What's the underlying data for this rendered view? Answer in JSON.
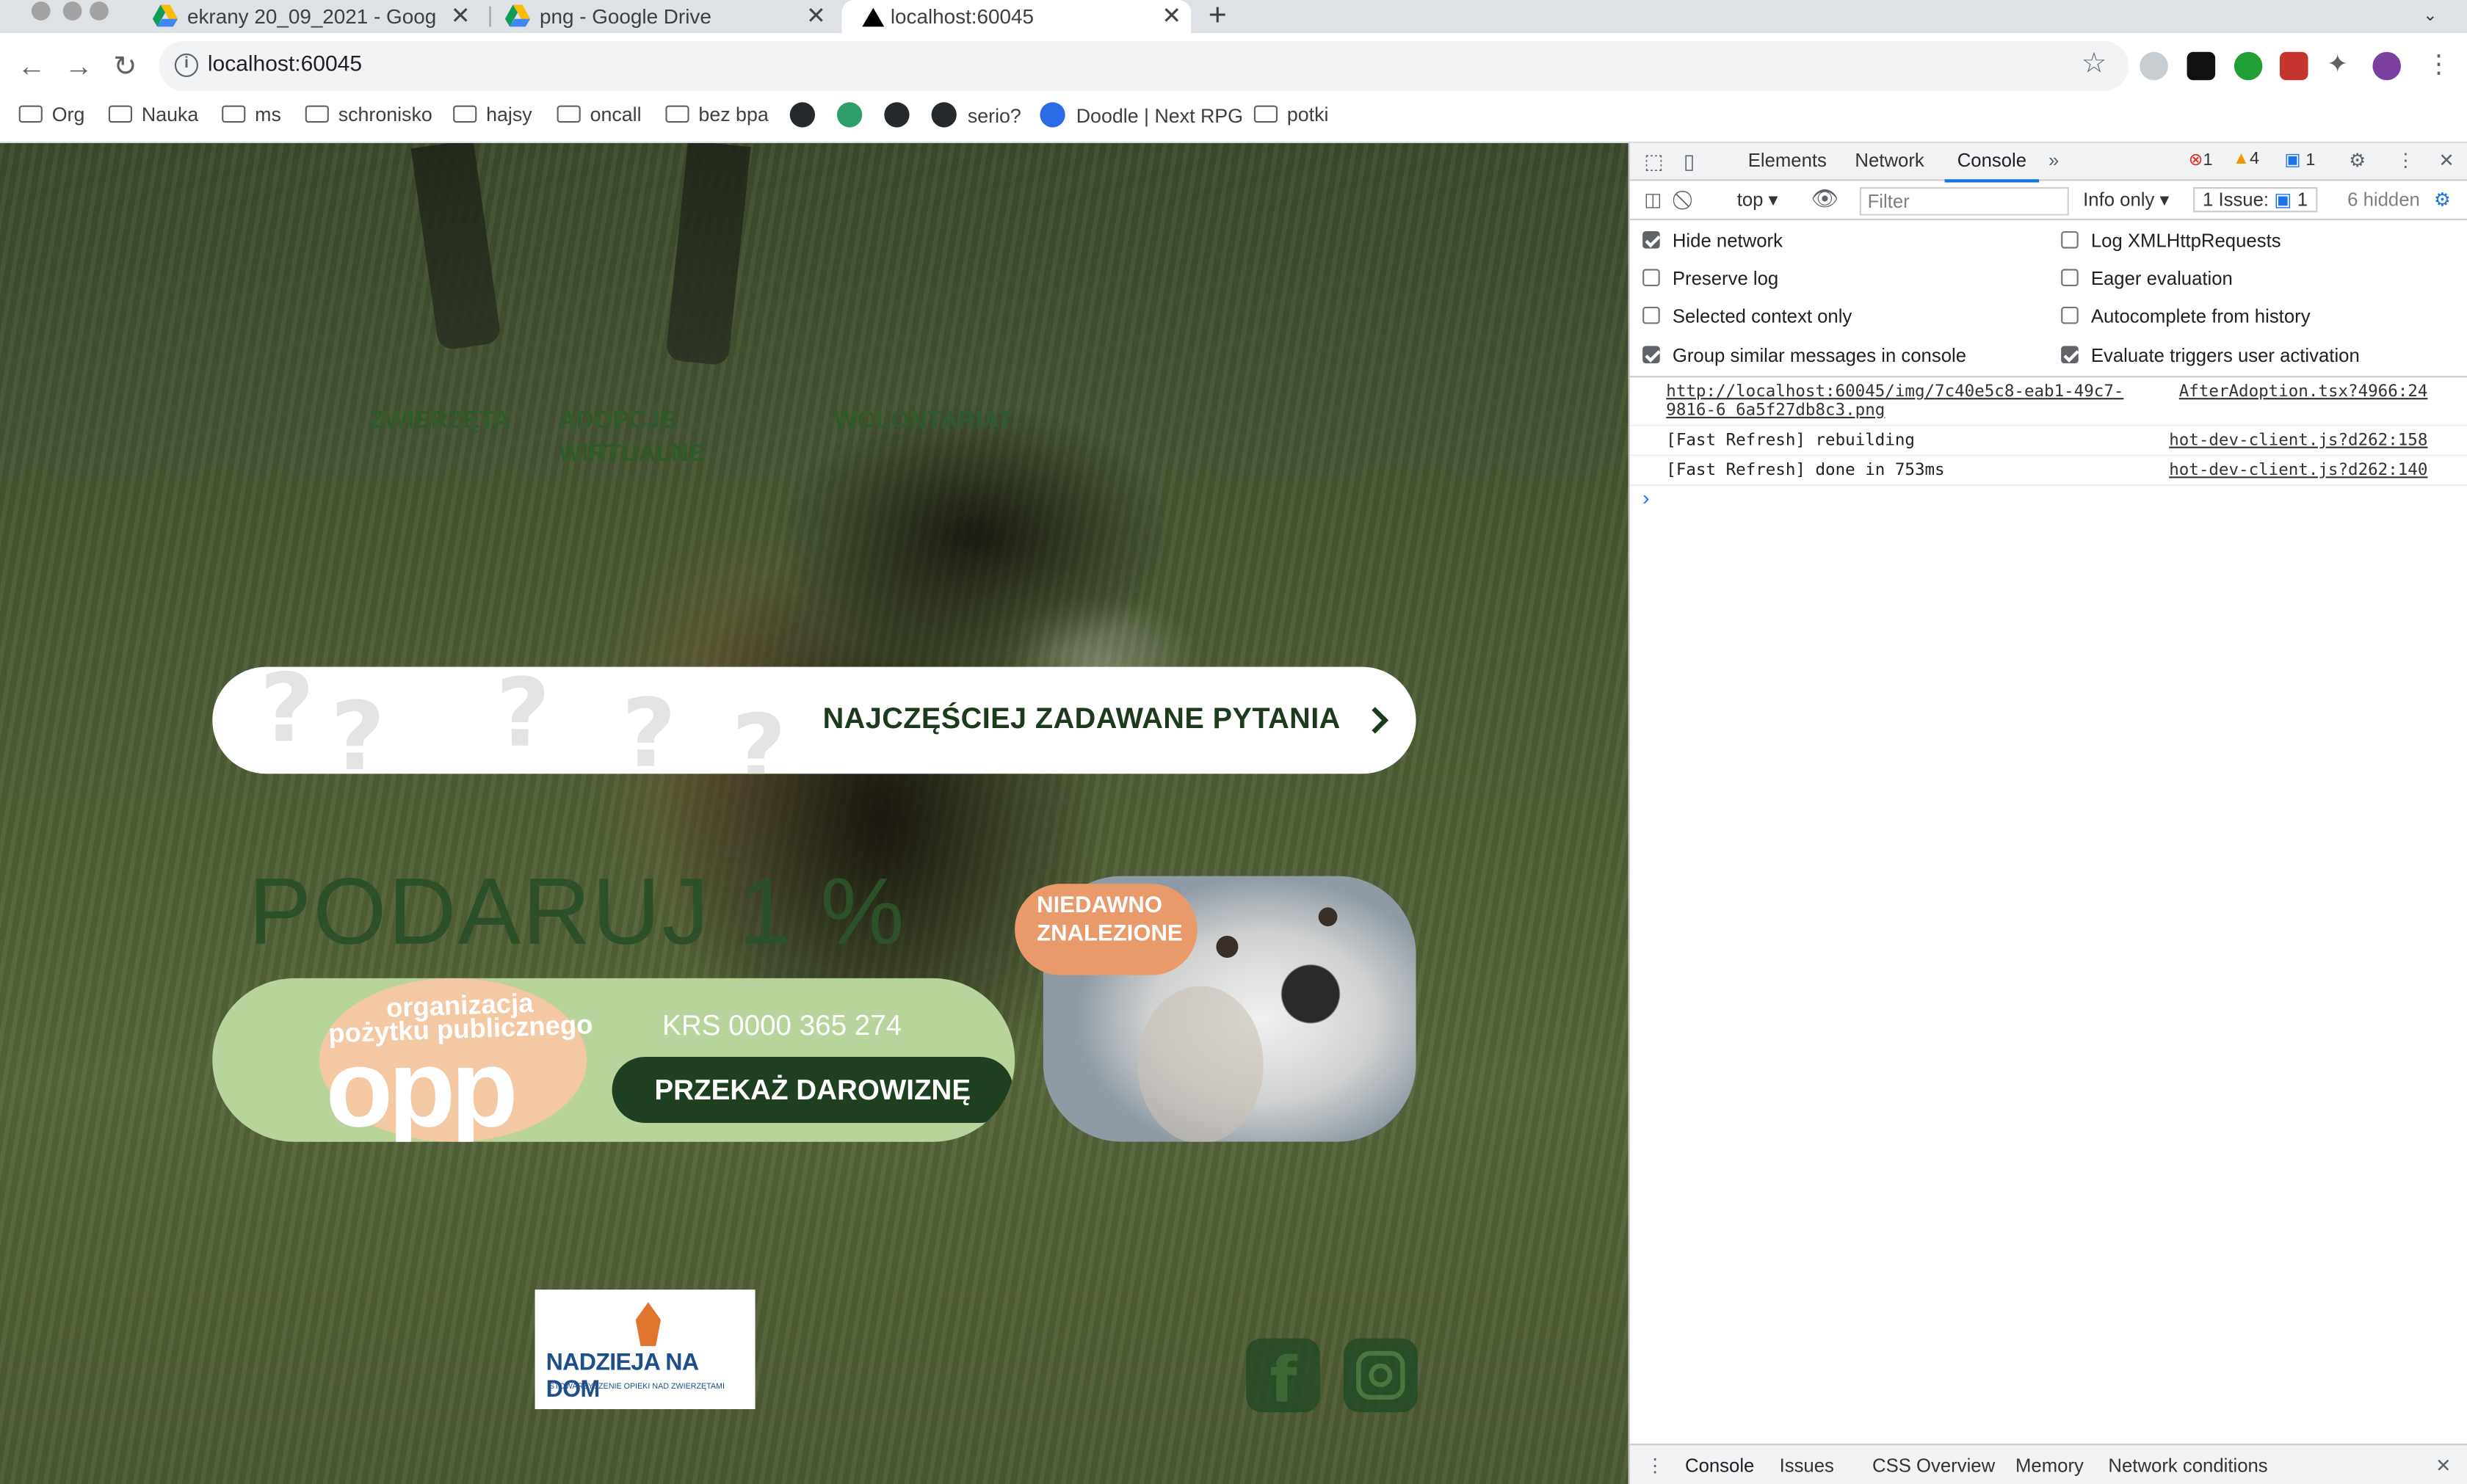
{
  "browser": {
    "tabs": [
      {
        "title": "ekrany 20_09_2021 - Google Dr",
        "icon": "google-drive-icon"
      },
      {
        "title": "png - Google Drive",
        "icon": "google-drive-icon"
      },
      {
        "title": "localhost:60045",
        "icon": "triangle-icon",
        "active": true
      }
    ],
    "new_tab": "+",
    "url": "localhost:60045",
    "bookmarks": [
      "Org",
      "Nauka",
      "ms",
      "schronisko",
      "hajsy",
      "oncall",
      "bez bpa",
      "serio?",
      "Doodle | Next RPG",
      "potki"
    ]
  },
  "page": {
    "menu": [
      "ZWIERZĘTA",
      "ADOPCJE WIRTUALNE",
      "WOLONTARIAT"
    ],
    "faq_label": "NAJCZĘŚCIEJ ZADAWANE PYTANIA",
    "donate_heading": "PODARUJ 1 %",
    "opp_line1": "organizacja",
    "opp_line2": "pożytku publicznego",
    "opp_big": "opp",
    "krs": "KRS 0000 365 274",
    "donate_button": "PRZEKAŻ DAROWIZNĘ",
    "found_badge_1": "NIEDAWNO",
    "found_badge_2": "ZNALEZIONE",
    "logo_name": "NADZIEJA NA DOM",
    "logo_sub": "STOWARZYSZENIE OPIEKI NAD ZWIERZĘTAMI"
  },
  "devtools": {
    "tabs": [
      "Elements",
      "Network",
      "Console"
    ],
    "selected_tab": "Console",
    "errors": "1",
    "warnings": "4",
    "info": "1",
    "context": "top",
    "filter_placeholder": "Filter",
    "level": "Info only",
    "issues": "1 Issue:",
    "issues_count": "1",
    "hidden": "6 hidden",
    "settings_left": [
      {
        "label": "Hide network",
        "checked": true
      },
      {
        "label": "Preserve log",
        "checked": false
      },
      {
        "label": "Selected context only",
        "checked": false
      },
      {
        "label": "Group similar messages in console",
        "checked": true
      }
    ],
    "settings_right": [
      {
        "label": "Log XMLHttpRequests",
        "checked": false
      },
      {
        "label": "Eager evaluation",
        "checked": false
      },
      {
        "label": "Autocomplete from history",
        "checked": false
      },
      {
        "label": "Evaluate triggers user activation",
        "checked": true
      }
    ],
    "messages": [
      {
        "text": "http://localhost:60045/img/7c40e5c8-eab1-49c7-9816-6 6a5f27db8c3.png",
        "source": "AfterAdoption.tsx?4966:24"
      },
      {
        "text": "[Fast Refresh] rebuilding",
        "source": "hot-dev-client.js?d262:158"
      },
      {
        "text": "[Fast Refresh] done in 753ms",
        "source": "hot-dev-client.js?d262:140"
      }
    ],
    "bottom_tabs": [
      "Console",
      "Issues",
      "CSS Overview",
      "Memory",
      "Network conditions"
    ]
  },
  "colors": {
    "accent_green": "#1f3f22",
    "light_green": "#b9d49a",
    "peach": "#e99a6a",
    "devtools_blue": "#1a73e8"
  }
}
